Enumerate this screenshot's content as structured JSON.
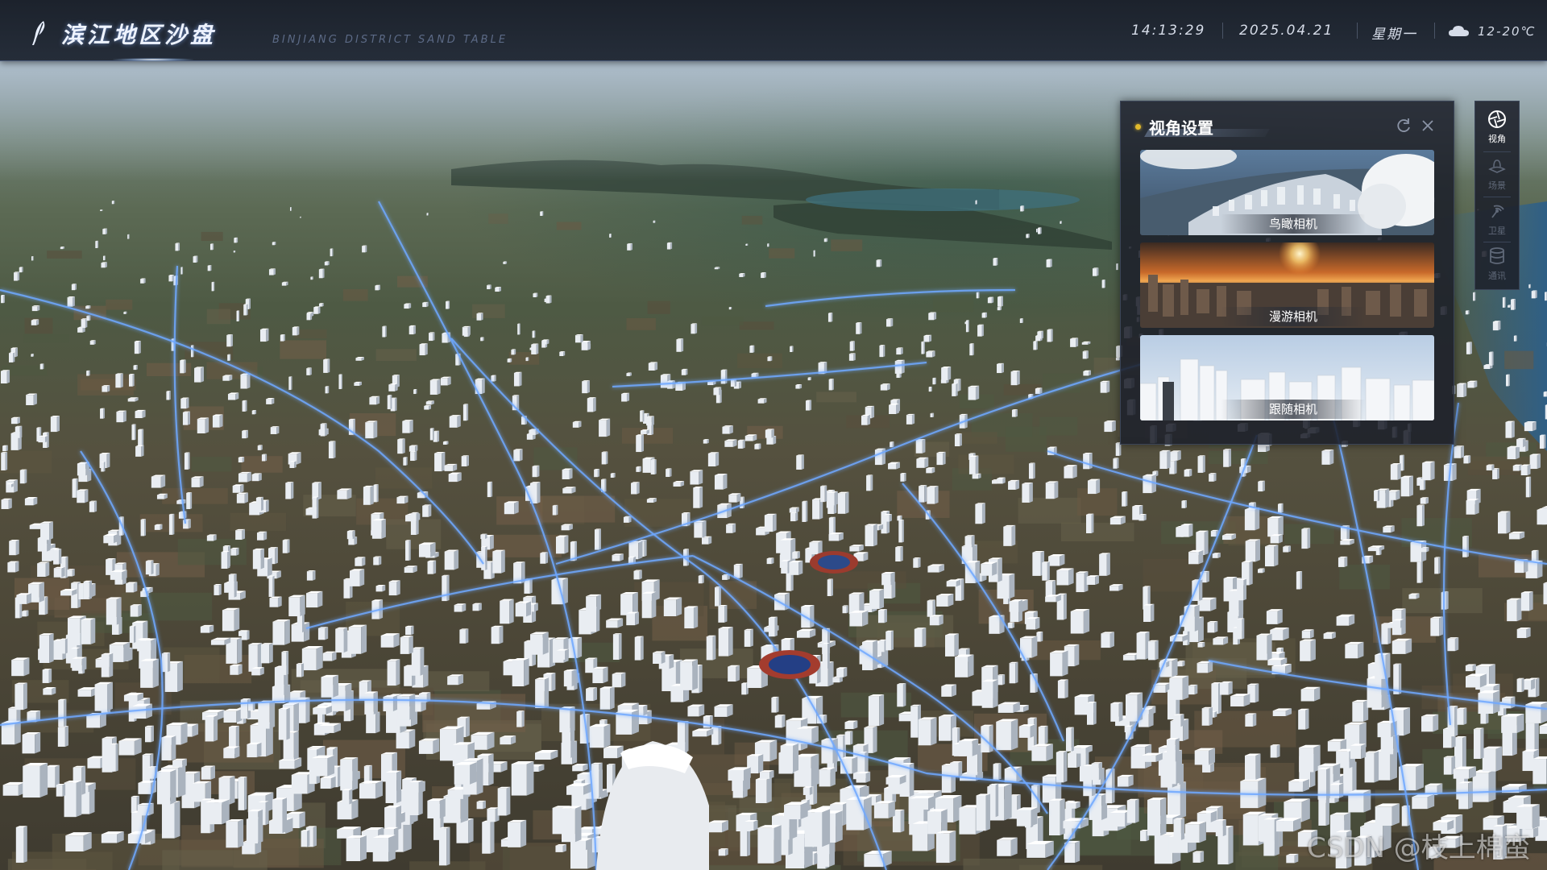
{
  "header": {
    "title": "滨江地区沙盘",
    "subtitle": "BINJIANG DISTRICT SAND TABLE",
    "time": "14:13:29",
    "date": "2025.04.21",
    "weekday": "星期一",
    "temperature": "12-20℃",
    "weather_icon": "cloud-icon"
  },
  "camera_panel": {
    "title": "视角设置",
    "refresh_icon": "refresh-icon",
    "close_icon": "close-icon",
    "cards": [
      {
        "label": "鸟瞰相机"
      },
      {
        "label": "漫游相机"
      },
      {
        "label": "跟随相机"
      }
    ]
  },
  "toolbar": {
    "items": [
      {
        "label": "视角",
        "icon": "aperture-icon",
        "active": true
      },
      {
        "label": "场景",
        "icon": "layers-icon",
        "active": false
      },
      {
        "label": "卫星",
        "icon": "satellite-icon",
        "active": false
      },
      {
        "label": "通讯",
        "icon": "database-icon",
        "active": false
      }
    ]
  },
  "watermark": "CSDN @枝上棉蛮",
  "colors": {
    "accent_dot": "#e0b92c",
    "road_glow": "#6fa8ff",
    "panel_bg": "#1c202a"
  }
}
